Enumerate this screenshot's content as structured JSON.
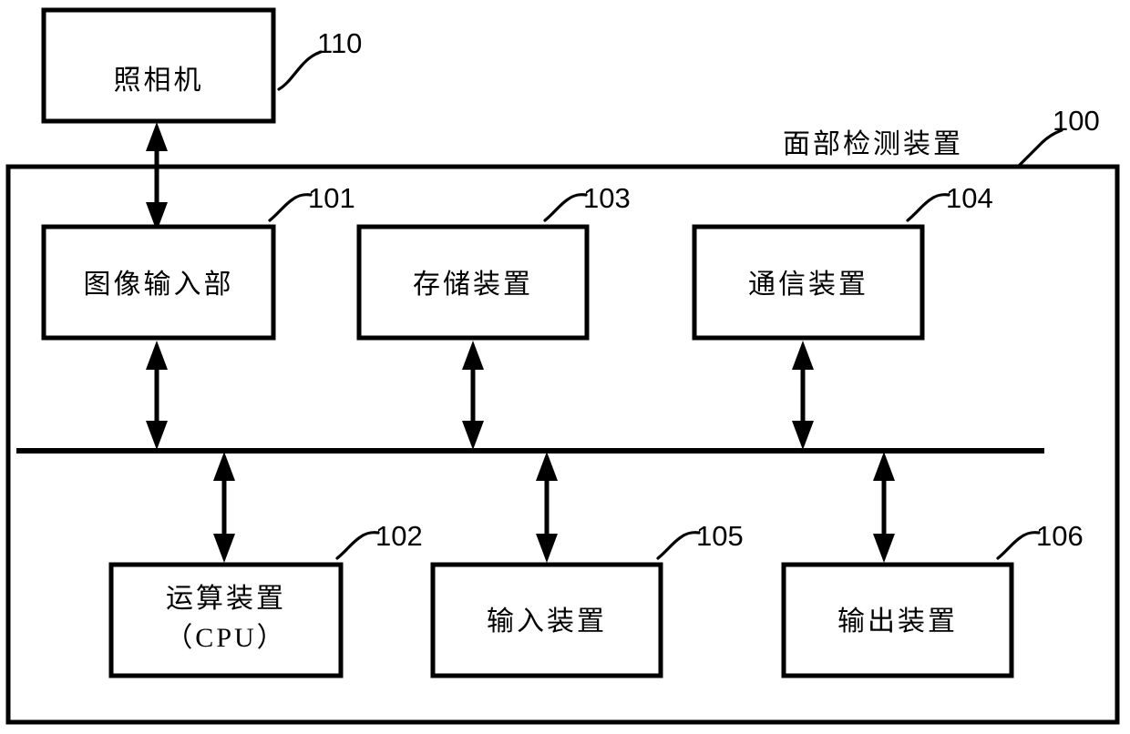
{
  "figure": {
    "kind": "patent-block-diagram",
    "background_color": "#ffffff",
    "line_color": "#000000"
  },
  "container": {
    "title": "面部检测装置",
    "ref": "100"
  },
  "external": {
    "camera": {
      "label": "照相机",
      "ref": "110"
    }
  },
  "bus": {
    "name": "system-bus"
  },
  "upper_blocks": [
    {
      "label": "图像输入部",
      "ref": "101",
      "name": "image-input-unit"
    },
    {
      "label": "存储装置",
      "ref": "103",
      "name": "storage-device"
    },
    {
      "label": "通信装置",
      "ref": "104",
      "name": "communication-device"
    }
  ],
  "lower_blocks": [
    {
      "label_line1": "运算装置",
      "label_line2": "（CPU）",
      "ref": "102",
      "name": "arithmetic-unit-cpu"
    },
    {
      "label_line1": "输入装置",
      "label_line2": "",
      "ref": "105",
      "name": "input-device"
    },
    {
      "label_line1": "输出装置",
      "label_line2": "",
      "ref": "106",
      "name": "output-device"
    }
  ]
}
